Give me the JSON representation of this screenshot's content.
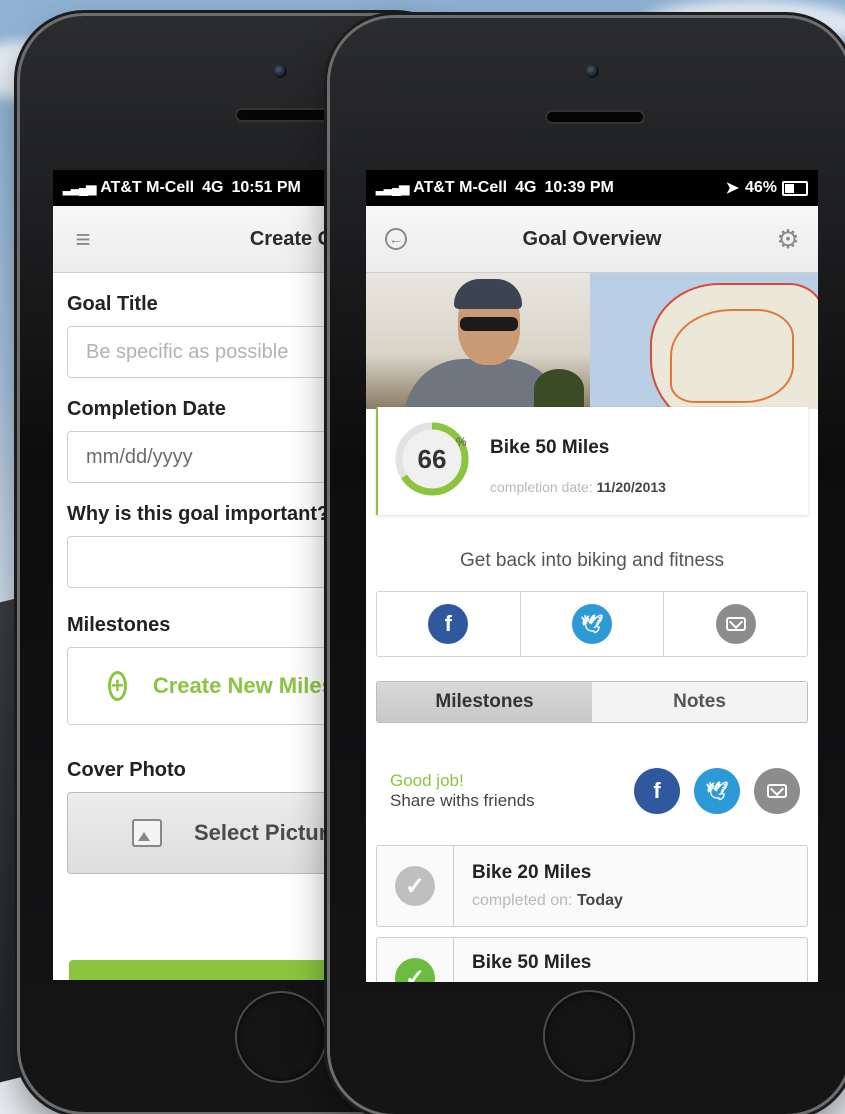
{
  "left_phone": {
    "status": {
      "carrier": "AT&T M-Cell",
      "network": "4G",
      "time": "10:51 PM"
    },
    "nav": {
      "title": "Create Goal"
    },
    "form": {
      "goal_title_label": "Goal Title",
      "goal_title_placeholder": "Be specific as possible",
      "completion_date_label": "Completion Date",
      "completion_date_placeholder": "mm/dd/yyyy",
      "why_label": "Why is this goal important?",
      "milestones_label": "Milestones",
      "create_milestone_label": "Create New Milestone",
      "cover_photo_label": "Cover Photo",
      "select_picture_label": "Select Picture"
    }
  },
  "right_phone": {
    "status": {
      "carrier": "AT&T M-Cell",
      "network": "4G",
      "time": "10:39 PM",
      "battery": "46%"
    },
    "nav": {
      "title": "Goal Overview"
    },
    "goal": {
      "percent": "66",
      "percent_sign": "%",
      "progress": 0.66,
      "title": "Bike 50 Miles",
      "completion_label": "completion date:",
      "completion_date": "11/20/2013",
      "description": "Get back into biking and fitness"
    },
    "tabs": [
      {
        "label": "Milestones",
        "active": true
      },
      {
        "label": "Notes",
        "active": false
      }
    ],
    "share": {
      "good_job": "Good job!",
      "share_text": "Share withs friends"
    },
    "milestones": [
      {
        "name": "Bike 20 Miles",
        "completed_label": "completed on:",
        "completed_value": "Today",
        "status": "gray"
      },
      {
        "name": "Bike 50 Miles",
        "status": "green"
      }
    ]
  },
  "colors": {
    "accent": "#8bc53f",
    "facebook": "#30589e",
    "twitter": "#2d9ad8",
    "email": "#8c8c8c"
  },
  "icons": {
    "facebook": "f",
    "twitter": "bird",
    "email": "envelope",
    "check": "✓",
    "plus": "+"
  }
}
